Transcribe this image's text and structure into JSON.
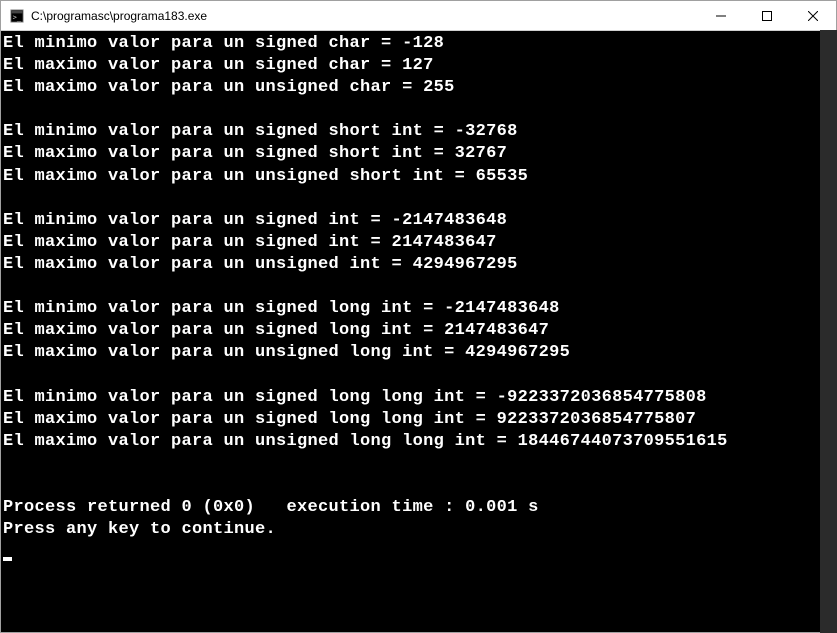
{
  "window": {
    "title": "C:\\programasc\\programa183.exe"
  },
  "console": {
    "lines": [
      "El minimo valor para un signed char = -128",
      "El maximo valor para un signed char = 127",
      "El maximo valor para un unsigned char = 255",
      "",
      "El minimo valor para un signed short int = -32768",
      "El maximo valor para un signed short int = 32767",
      "El maximo valor para un unsigned short int = 65535",
      "",
      "El minimo valor para un signed int = -2147483648",
      "El maximo valor para un signed int = 2147483647",
      "El maximo valor para un unsigned int = 4294967295",
      "",
      "El minimo valor para un signed long int = -2147483648",
      "El maximo valor para un signed long int = 2147483647",
      "El maximo valor para un unsigned long int = 4294967295",
      "",
      "El minimo valor para un signed long long int = -9223372036854775808",
      "El maximo valor para un signed long long int = 9223372036854775807",
      "El maximo valor para un unsigned long long int = 18446744073709551615",
      "",
      "",
      "Process returned 0 (0x0)   execution time : 0.001 s",
      "Press any key to continue."
    ]
  }
}
